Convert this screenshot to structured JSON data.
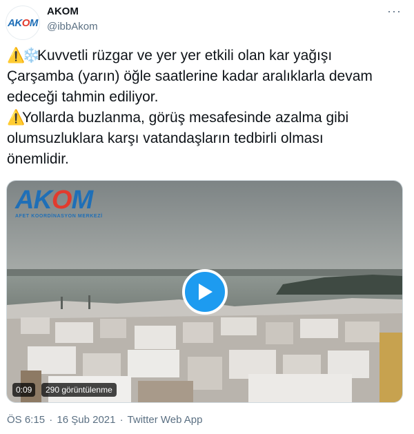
{
  "author": {
    "name": "AKOM",
    "handle": "@ibbAkom",
    "avatar_text_a": "AK",
    "avatar_text_b": "O",
    "avatar_text_c": "M"
  },
  "menu": {
    "more_icon": "more-dots-icon",
    "glyph": "···"
  },
  "tweet": {
    "line1": "Kuvvetli rüzgar ve yer yer etkili olan kar yağışı",
    "line2": "Çarşamba (yarın) öğle saatlerine kadar aralıklarla devam",
    "line3": "edeceği tahmin ediliyor.",
    "line4": "Yollarda buzlanma, görüş mesafesinde azalma gibi",
    "line5": "olumsuzluklara karşı vatandaşların tedbirli olması",
    "line6": "önemlidir.",
    "warning_glyph": "⚠️",
    "snow_glyph": "❄️"
  },
  "video": {
    "logo_a": "AK",
    "logo_b": "O",
    "logo_c": "M",
    "logo_subtitle": "AFET KOORDİNASYON MERKEZİ",
    "duration": "0:09",
    "views": "290 görüntülenme",
    "play_icon": "play-icon"
  },
  "meta": {
    "time": "ÖS 6:15",
    "date": "16 Şub 2021",
    "separator": "·",
    "source": "Twitter Web App"
  },
  "colors": {
    "brand_blue": "#1f6fb7",
    "brand_red": "#e23b2e",
    "play_blue": "#1d9bf0",
    "muted": "#5b7083"
  }
}
